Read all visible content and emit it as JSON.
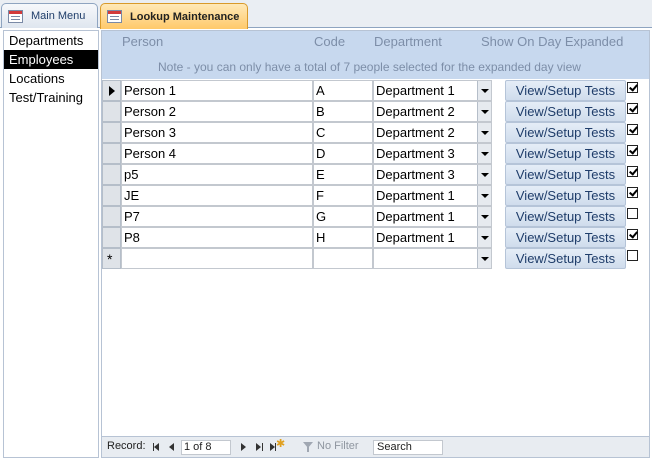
{
  "tabs": [
    {
      "label": "Main Menu"
    },
    {
      "label": "Lookup Maintenance"
    }
  ],
  "nav": {
    "items": [
      "Departments",
      "Employees",
      "Locations",
      "Test/Training"
    ],
    "selected": "Employees"
  },
  "form": {
    "headers": {
      "person": "Person",
      "code": "Code",
      "department": "Department",
      "show": "Show On Day Expanded"
    },
    "note": "Note - you can only have a total of 7 people selected for the expanded day view",
    "button_label": "View/Setup Tests",
    "rows": [
      {
        "person": "Person 1",
        "code": "A",
        "department": "Department 1",
        "show": true
      },
      {
        "person": "Person 2",
        "code": "B",
        "department": "Department 2",
        "show": true
      },
      {
        "person": "Person 3",
        "code": "C",
        "department": "Department 2",
        "show": true
      },
      {
        "person": "Person 4",
        "code": "D",
        "department": "Department 3",
        "show": true
      },
      {
        "person": "p5",
        "code": "E",
        "department": "Department 3",
        "show": true
      },
      {
        "person": "JE",
        "code": "F",
        "department": "Department 1",
        "show": true
      },
      {
        "person": "P7",
        "code": "G",
        "department": "Department 1",
        "show": false
      },
      {
        "person": "P8",
        "code": "H",
        "department": "Department 1",
        "show": true
      }
    ],
    "new_row_marker": "*"
  },
  "record_nav": {
    "label": "Record:",
    "position": "1 of 8",
    "filter": "No Filter",
    "search": "Search"
  },
  "colors": {
    "header_bg": "#c7d8ee",
    "active_tab": "#ffc96a",
    "nav_selected_bg": "#000000"
  }
}
